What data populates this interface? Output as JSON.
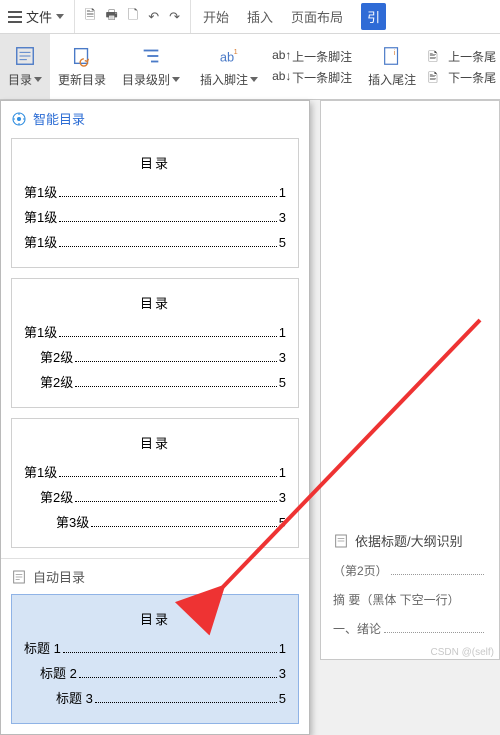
{
  "menubar": {
    "file": "文件",
    "tabs": {
      "start": "开始",
      "insert": "插入",
      "layout": "页面布局",
      "ref": "引"
    }
  },
  "ribbon": {
    "toc": "目录",
    "update": "更新目录",
    "level": "目录级别",
    "insert_footnote": "插入脚注",
    "prev_footnote": "上一条脚注",
    "next_footnote": "下一条脚注",
    "insert_endnote": "插入尾注",
    "prev_endnote": "上一条尾",
    "next_endnote": "下一条尾"
  },
  "dropdown": {
    "smart": "智能目录",
    "auto": "自动目录",
    "toc_title": "目录",
    "p1": {
      "lv": "第1级",
      "pages": [
        "1",
        "3",
        "5"
      ]
    },
    "p2": {
      "l1": "第1级",
      "l2": "第2级",
      "pgs": [
        "1",
        "3",
        "5"
      ]
    },
    "p3": {
      "l1": "第1级",
      "l2": "第2级",
      "l3": "第3级",
      "pgs": [
        "1",
        "3",
        "5"
      ]
    },
    "p4": {
      "h1": "标题 1",
      "h2": "标题 2",
      "h3": "标题 3",
      "pgs": [
        "1",
        "3",
        "5"
      ]
    }
  },
  "page": {
    "heading": "依据标题/大纲识别",
    "row1": "（第2页）",
    "row2": "摘 要（黑体    下空一行）",
    "row3": "一、绪论"
  },
  "watermark": "CSDN @(self)"
}
